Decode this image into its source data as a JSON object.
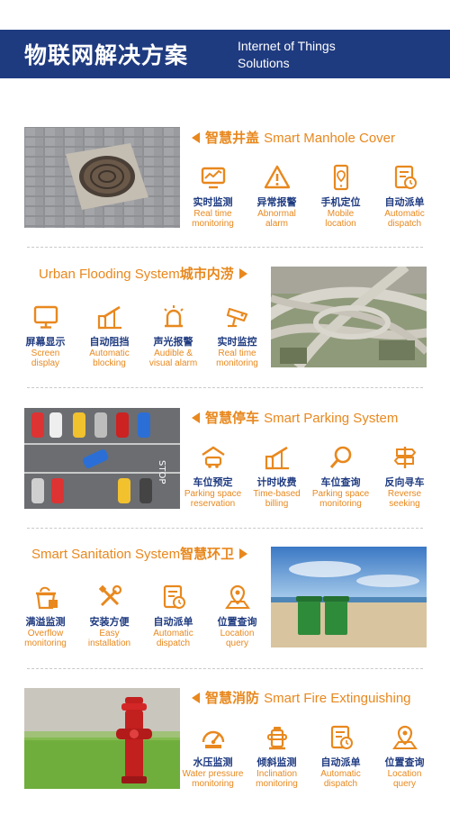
{
  "header": {
    "title_cn": "物联网解决方案",
    "title_en_1": "Internet of Things",
    "title_en_2": "Solutions"
  },
  "colors": {
    "navy": "#1f3b80",
    "orange": "#e8881e"
  },
  "sections": [
    {
      "title_cn": "智慧井盖",
      "title_en": "Smart Manhole Cover",
      "features": [
        {
          "cn": "实时监测",
          "en": "Real time\nmonitoring",
          "icon": "monitor-chart-icon"
        },
        {
          "cn": "异常报警",
          "en": "Abnormal\nalarm",
          "icon": "warning-triangle-icon"
        },
        {
          "cn": "手机定位",
          "en": "Mobile\nlocation",
          "icon": "phone-location-icon"
        },
        {
          "cn": "自动派单",
          "en": "Automatic\ndispatch",
          "icon": "dispatch-document-icon"
        }
      ]
    },
    {
      "title_cn": "城市内涝",
      "title_en": "Urban Flooding System",
      "features": [
        {
          "cn": "屏幕显示",
          "en": "Screen\ndisplay",
          "icon": "screen-icon"
        },
        {
          "cn": "自动阻挡",
          "en": "Automatic\nblocking",
          "icon": "barrier-gate-icon"
        },
        {
          "cn": "声光报警",
          "en": "Audible &\nvisual alarm",
          "icon": "siren-icon"
        },
        {
          "cn": "实时监控",
          "en": "Real time\nmonitoring",
          "icon": "cctv-camera-icon"
        }
      ]
    },
    {
      "title_cn": "智慧停车",
      "title_en": "Smart Parking System",
      "features": [
        {
          "cn": "车位预定",
          "en": "Parking space\nreservation",
          "icon": "car-garage-icon"
        },
        {
          "cn": "计时收费",
          "en": "Time-based\nbilling",
          "icon": "billing-gate-icon"
        },
        {
          "cn": "车位查询",
          "en": "Parking space\nmonitoring",
          "icon": "search-icon"
        },
        {
          "cn": "反向寻车",
          "en": "Reverse\nseeking",
          "icon": "signpost-icon"
        }
      ]
    },
    {
      "title_cn": "智慧环卫",
      "title_en": "Smart Sanitation System",
      "features": [
        {
          "cn": "满溢监测",
          "en": "Overflow\nmonitoring",
          "icon": "overflow-bin-icon"
        },
        {
          "cn": "安装方便",
          "en": "Easy\ninstallation",
          "icon": "tools-icon"
        },
        {
          "cn": "自动派单",
          "en": "Automatic\ndispatch",
          "icon": "dispatch-document-icon"
        },
        {
          "cn": "位置查询",
          "en": "Location\nquery",
          "icon": "map-pin-icon"
        }
      ]
    },
    {
      "title_cn": "智慧消防",
      "title_en": "Smart Fire Extinguishing",
      "features": [
        {
          "cn": "水压监测",
          "en": "Water pressure\nmonitoring",
          "icon": "gauge-icon"
        },
        {
          "cn": "倾斜监测",
          "en": "Inclination\nmonitoring",
          "icon": "hydrant-icon"
        },
        {
          "cn": "自动派单",
          "en": "Automatic\ndispatch",
          "icon": "dispatch-document-icon"
        },
        {
          "cn": "位置查询",
          "en": "Location\nquery",
          "icon": "map-pin-icon"
        }
      ]
    }
  ]
}
